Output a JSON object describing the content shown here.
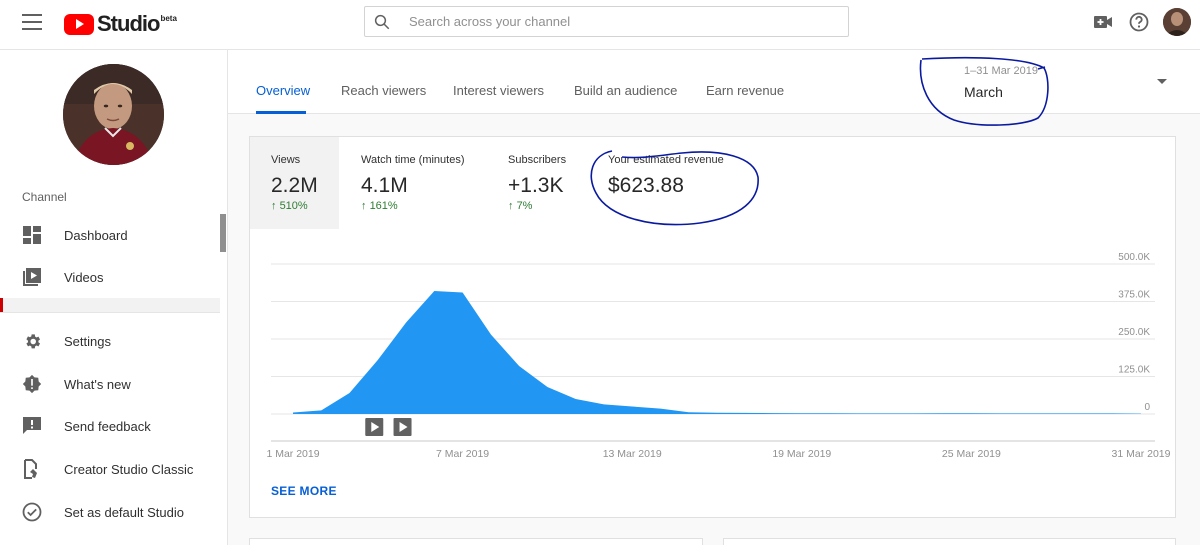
{
  "header": {
    "logo_text": "Studio",
    "logo_badge": "beta",
    "search_placeholder": "Search across your channel"
  },
  "sidebar": {
    "channel_label": "Channel",
    "items": [
      {
        "label": "Dashboard",
        "icon": "dashboard-icon"
      },
      {
        "label": "Videos",
        "icon": "videos-icon"
      },
      {
        "label": "Settings",
        "icon": "gear-icon"
      },
      {
        "label": "What's new",
        "icon": "alert-icon"
      },
      {
        "label": "Send feedback",
        "icon": "feedback-icon"
      },
      {
        "label": "Creator Studio Classic",
        "icon": "classic-icon"
      },
      {
        "label": "Set as default Studio",
        "icon": "check-circle-icon"
      }
    ]
  },
  "tabs": [
    {
      "label": "Overview",
      "active": true
    },
    {
      "label": "Reach viewers",
      "active": false
    },
    {
      "label": "Interest viewers",
      "active": false
    },
    {
      "label": "Build an audience",
      "active": false
    },
    {
      "label": "Earn revenue",
      "active": false
    }
  ],
  "date_picker": {
    "range": "1–31 Mar 2019",
    "label": "March"
  },
  "metrics": [
    {
      "label": "Views",
      "value": "2.2M",
      "delta": "510%",
      "selected": true
    },
    {
      "label": "Watch time (minutes)",
      "value": "4.1M",
      "delta": "161%",
      "selected": false
    },
    {
      "label": "Subscribers",
      "value": "+1.3K",
      "delta": "7%",
      "selected": false
    },
    {
      "label": "Your estimated revenue",
      "value": "$623.88",
      "delta": "",
      "selected": false
    }
  ],
  "see_more": "SEE MORE",
  "colors": {
    "accent_blue": "#065fd4",
    "chart_fill": "#2196f3",
    "positive_green": "#2e7d32",
    "annotation_ink": "#0a1aa0"
  },
  "chart_data": {
    "type": "area",
    "series": [
      {
        "values": [
          5000,
          12000,
          70000,
          180000,
          305000,
          410000,
          405000,
          265000,
          160000,
          90000,
          50000,
          32000,
          25000,
          18000,
          6000,
          4000,
          3500,
          3000,
          2500,
          2500,
          2000,
          2000,
          2000,
          2500,
          2500,
          2000,
          2000,
          2000,
          2000,
          2000,
          1500
        ]
      }
    ],
    "x": [
      "1 Mar 2019",
      "2 Mar 2019",
      "3 Mar 2019",
      "4 Mar 2019",
      "5 Mar 2019",
      "6 Mar 2019",
      "7 Mar 2019",
      "8 Mar 2019",
      "9 Mar 2019",
      "10 Mar 2019",
      "11 Mar 2019",
      "12 Mar 2019",
      "13 Mar 2019",
      "14 Mar 2019",
      "15 Mar 2019",
      "16 Mar 2019",
      "17 Mar 2019",
      "18 Mar 2019",
      "19 Mar 2019",
      "20 Mar 2019",
      "21 Mar 2019",
      "22 Mar 2019",
      "23 Mar 2019",
      "24 Mar 2019",
      "25 Mar 2019",
      "26 Mar 2019",
      "27 Mar 2019",
      "28 Mar 2019",
      "29 Mar 2019",
      "30 Mar 2019",
      "31 Mar 2019"
    ],
    "x_ticks": [
      "1 Mar 2019",
      "7 Mar 2019",
      "13 Mar 2019",
      "19 Mar 2019",
      "25 Mar 2019",
      "31 Mar 2019"
    ],
    "y_ticks": [
      "500.0K",
      "375.0K",
      "250.0K",
      "125.0K",
      "0"
    ],
    "ylim": [
      0,
      500000
    ],
    "grid": true,
    "markers": [
      "2 Mar 2019",
      "3 Mar 2019"
    ]
  }
}
